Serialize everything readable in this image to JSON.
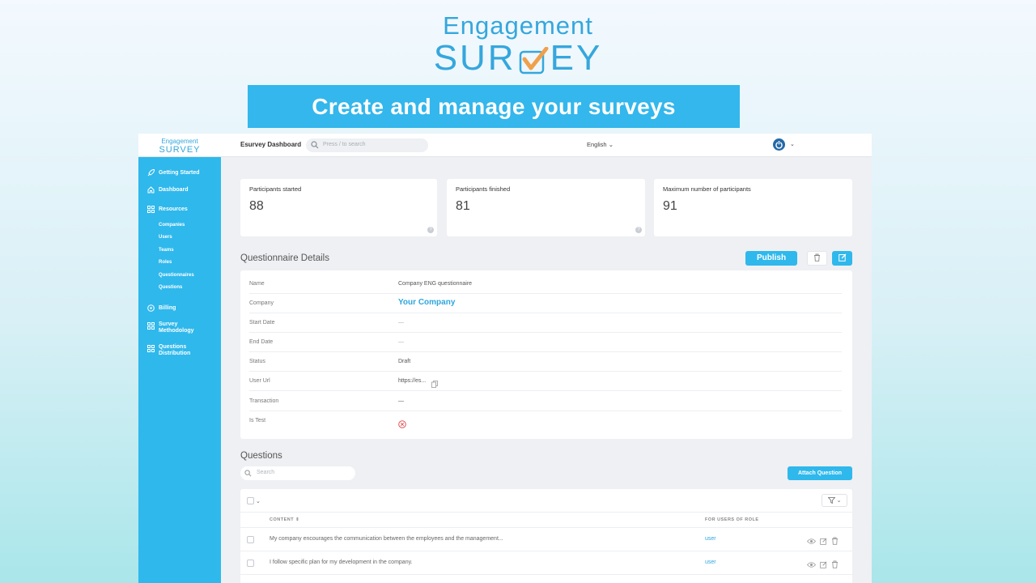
{
  "hero": {
    "logo_line1": "Engagement",
    "logo_line2_left": "SUR",
    "logo_line2_right": "EY",
    "banner": "Create and manage your surveys"
  },
  "topbar": {
    "logo_line1": "Engagement",
    "logo_line2": "SURVEY",
    "title": "Esurvey Dashboard",
    "search_placeholder": "Press / to search",
    "language": "English",
    "power_icon": "power-icon"
  },
  "sidebar": {
    "items": [
      {
        "label": "Getting Started",
        "icon": "rocket-icon"
      },
      {
        "label": "Dashboard",
        "icon": "home-icon"
      },
      {
        "label": "Resources",
        "icon": "grid-icon"
      },
      {
        "label": "Billing",
        "icon": "billing-icon"
      },
      {
        "label": "Survey Methodology",
        "icon": "grid-icon"
      },
      {
        "label": "Questions Distribution",
        "icon": "grid-icon"
      }
    ],
    "subitems": [
      "Companies",
      "Users",
      "Teams",
      "Roles",
      "Questionnaires",
      "Questions"
    ]
  },
  "stats": [
    {
      "label": "Participants started",
      "value": "88"
    },
    {
      "label": "Participants finished",
      "value": "81"
    },
    {
      "label": "Maximum number of participants",
      "value": "91"
    }
  ],
  "details": {
    "title": "Questionnaire Details",
    "publish_label": "Publish",
    "rows": [
      {
        "key": "Name",
        "value": "Company ENG questionnaire"
      },
      {
        "key": "Company",
        "value": "Your Company"
      },
      {
        "key": "Start Date",
        "value": "—"
      },
      {
        "key": "End Date",
        "value": "—"
      },
      {
        "key": "Status",
        "value": "Draft"
      },
      {
        "key": "User Url",
        "value": "https://es..."
      },
      {
        "key": "Transaction",
        "value": "—"
      },
      {
        "key": "Is Test",
        "value": ""
      }
    ]
  },
  "questions": {
    "title": "Questions",
    "search_placeholder": "Search",
    "attach_label": "Attach Question",
    "col_content": "CONTENT",
    "col_role": "FOR USERS OF ROLE",
    "rows": [
      {
        "content": "My company encourages the communication between the employees and the management...",
        "role": "user"
      },
      {
        "content": "I follow specific plan for my development in the company.",
        "role": "user"
      }
    ]
  },
  "colors": {
    "accent": "#2fb8ec",
    "brand": "#35a7dd",
    "check_orange": "#f0a04b"
  }
}
